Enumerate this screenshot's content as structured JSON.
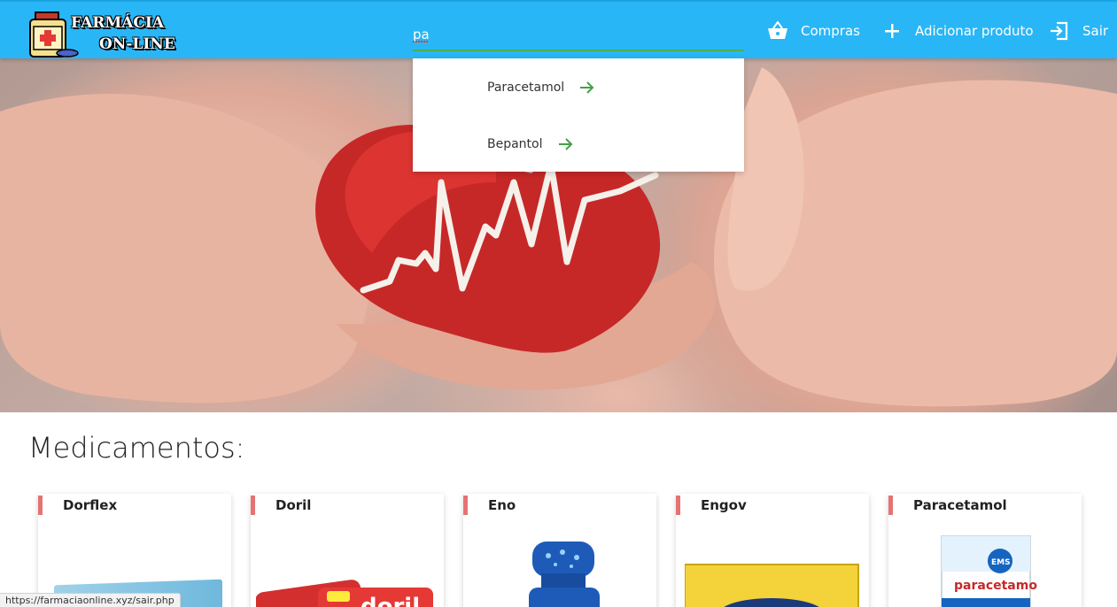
{
  "brand": {
    "line1": "FARMÁCIA",
    "line2": "ON-LINE"
  },
  "search": {
    "value": "pa"
  },
  "nav": [
    {
      "label": "Compras",
      "icon": "basket-icon"
    },
    {
      "label": "Adicionar produto",
      "icon": "plus-icon"
    },
    {
      "label": "Sair",
      "icon": "exit-icon"
    }
  ],
  "suggestions": [
    {
      "label": "Paracetamol",
      "icon": "arrow-right-icon"
    },
    {
      "label": "Bepantol",
      "icon": "arrow-right-icon"
    }
  ],
  "section": {
    "title": "Medicamentos:"
  },
  "products": [
    {
      "name": "Dorflex"
    },
    {
      "name": "Doril"
    },
    {
      "name": "Eno"
    },
    {
      "name": "Engov"
    },
    {
      "name": "Paracetamol"
    }
  ],
  "status": {
    "url": "https://farmaciaonline.xyz/sair.php"
  },
  "colors": {
    "navbar": "#29b6f6",
    "accent": "#e57373",
    "search_underline": "#4caf50"
  }
}
